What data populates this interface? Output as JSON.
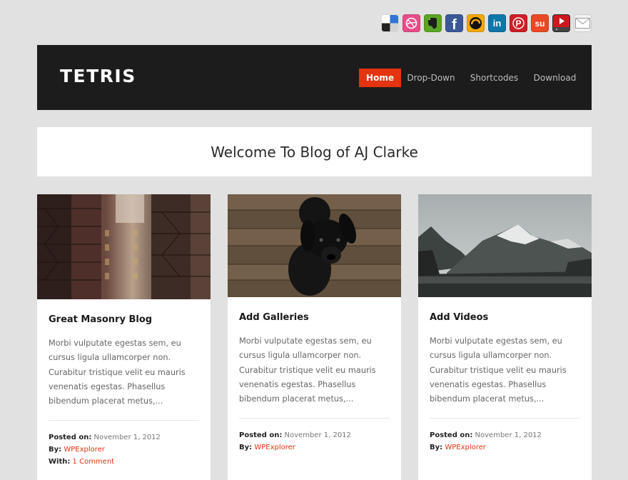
{
  "social": [
    {
      "name": "delicious-icon",
      "glyph": "",
      "color": "#3274d1"
    },
    {
      "name": "dribbble-icon",
      "glyph": "",
      "color": "#ea4c89"
    },
    {
      "name": "evernote-icon",
      "glyph": "",
      "color": "#5ba525"
    },
    {
      "name": "facebook-icon",
      "glyph": "f",
      "color": "#3b5998"
    },
    {
      "name": "grooveshark-icon",
      "glyph": "",
      "color": "#f2a900"
    },
    {
      "name": "linkedin-icon",
      "glyph": "in",
      "color": "#0e76a8"
    },
    {
      "name": "pinterest-icon",
      "glyph": "P",
      "color": "#cb2027"
    },
    {
      "name": "stumbleupon-icon",
      "glyph": "su",
      "color": "#eb4924"
    },
    {
      "name": "youtube-icon",
      "glyph": "",
      "color": "#cc181e"
    },
    {
      "name": "mail-icon",
      "glyph": "",
      "color": "#f2f2f2"
    }
  ],
  "header": {
    "logo": "TETRIS",
    "nav": [
      "Home",
      "Drop-Down",
      "Shortcodes",
      "Download"
    ],
    "active_index": 0,
    "accent": "#e5330f"
  },
  "welcome": {
    "title": "Welcome To Blog of AJ Clarke"
  },
  "posts": [
    {
      "title": "Great Masonry Blog",
      "excerpt": "Morbi vulputate egestas sem, eu cursus ligula ullamcorper non. Curabitur tristique velit eu mauris venenatis egestas. Phasellus bibendum placerat metus,...",
      "posted_label": "Posted on:",
      "posted_value": "November 1, 2012",
      "by_label": "By:",
      "by_value": "WPExplorer",
      "with_label": "With:",
      "with_value": "1 Comment"
    },
    {
      "title": "Add Galleries",
      "excerpt": "Morbi vulputate egestas sem, eu cursus ligula ullamcorper non. Curabitur tristique velit eu mauris venenatis egestas. Phasellus bibendum placerat metus,...",
      "posted_label": "Posted on:",
      "posted_value": "November 1, 2012",
      "by_label": "By:",
      "by_value": "WPExplorer"
    },
    {
      "title": "Add Videos",
      "excerpt": "Morbi vulputate egestas sem, eu cursus ligula ullamcorper non. Curabitur tristique velit eu mauris venenatis egestas. Phasellus bibendum placerat metus,...",
      "posted_label": "Posted on:",
      "posted_value": "November 1, 2012",
      "by_label": "By:",
      "by_value": "WPExplorer"
    }
  ]
}
